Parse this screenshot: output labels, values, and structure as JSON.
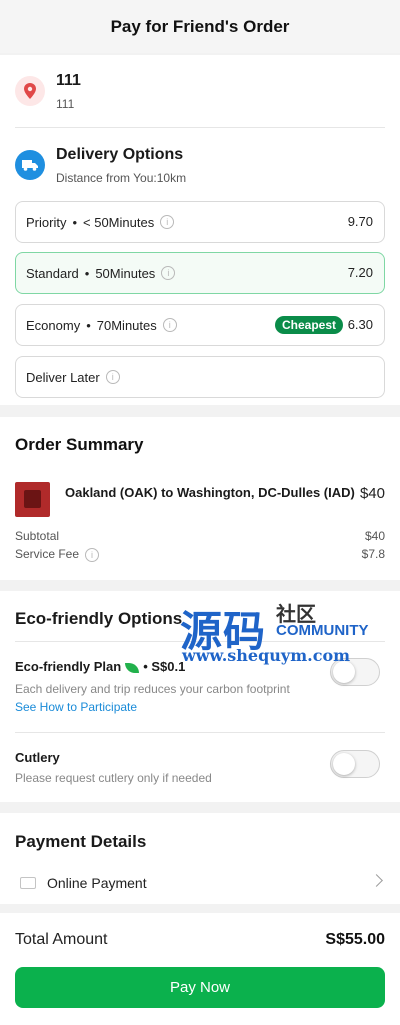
{
  "header": {
    "title": "Pay for Friend's Order"
  },
  "address": {
    "name": "111",
    "detail": "111",
    "icon": "location-pin-icon"
  },
  "delivery": {
    "title": "Delivery Options",
    "distance": "Distance from You:10km",
    "icon": "truck-icon",
    "options": [
      {
        "name": "Priority",
        "time": "< 50Minutes",
        "price": "9.70"
      },
      {
        "name": "Standard",
        "time": "50Minutes",
        "price": "7.20",
        "selected": true
      },
      {
        "name": "Economy",
        "time": "70Minutes",
        "price": "6.30",
        "badge": "Cheapest"
      },
      {
        "name": "Deliver Later",
        "time": "",
        "price": ""
      }
    ]
  },
  "order_summary": {
    "title": "Order Summary",
    "item": {
      "name": "Oakland (OAK) to Washington, DC-Dulles (IAD)",
      "price": "$40"
    },
    "subtotal_label": "Subtotal",
    "subtotal_value": "$40",
    "service_fee_label": "Service Fee",
    "service_fee_value": "$7.8"
  },
  "eco": {
    "title": "Eco-friendly Options",
    "plan_label": "Eco-friendly Plan",
    "plan_price": "• S$0.1",
    "plan_desc": "Each delivery and trip reduces your carbon footprint",
    "plan_link": "See How to Participate",
    "plan_on": false,
    "cutlery_label": "Cutlery",
    "cutlery_desc": "Please request cutlery only if needed",
    "cutlery_on": false
  },
  "payment": {
    "title": "Payment Details",
    "method": "Online Payment"
  },
  "footer": {
    "total_label": "Total Amount",
    "total_value": "S$55.00",
    "pay_button": "Pay Now"
  },
  "watermark": {
    "main": "源码",
    "side": "社区",
    "community": "COMMUNITY",
    "url": "www.shequym.com"
  },
  "colors": {
    "accent_green": "#0bb14d",
    "badge_green": "#0a8c49",
    "link_blue": "#1a8bd8",
    "truck_blue": "#1f8fe0"
  }
}
